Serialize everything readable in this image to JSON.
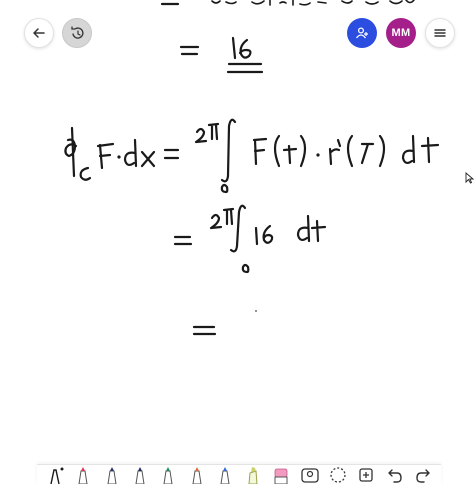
{
  "header": {
    "back_icon": "arrow-left-icon",
    "history_icon": "undo-history-icon",
    "share_icon": "person-share-icon",
    "avatar_initials": "MM",
    "menu_icon": "hamburger-menu-icon"
  },
  "colors": {
    "share_button": "#2b4de0",
    "avatar_bg": "#a51f8a",
    "ink": "#1a1a1a"
  },
  "toolbar": {
    "tools": [
      {
        "name": "pen-tool-icon",
        "color": "#1a1a1a"
      },
      {
        "name": "marker-red-icon",
        "color": "#e0334a"
      },
      {
        "name": "marker-dark-blue-icon",
        "color": "#23306e"
      },
      {
        "name": "marker-navy-icon",
        "color": "#1f2a5e"
      },
      {
        "name": "marker-green-icon",
        "color": "#1f8a5b"
      },
      {
        "name": "marker-orange-icon",
        "color": "#e06a2b"
      },
      {
        "name": "marker-blue-icon",
        "color": "#2b6ad8"
      },
      {
        "name": "highlighter-icon",
        "color": "#c9d36a"
      },
      {
        "name": "eraser-icon",
        "color": "#f29ac0"
      },
      {
        "name": "image-icon",
        "color": "#333333"
      },
      {
        "name": "lasso-select-icon",
        "color": "#333333"
      },
      {
        "name": "add-icon",
        "color": "#333333"
      },
      {
        "name": "undo-icon",
        "color": "#333333"
      },
      {
        "name": "redo-icon",
        "color": "#333333"
      }
    ]
  }
}
